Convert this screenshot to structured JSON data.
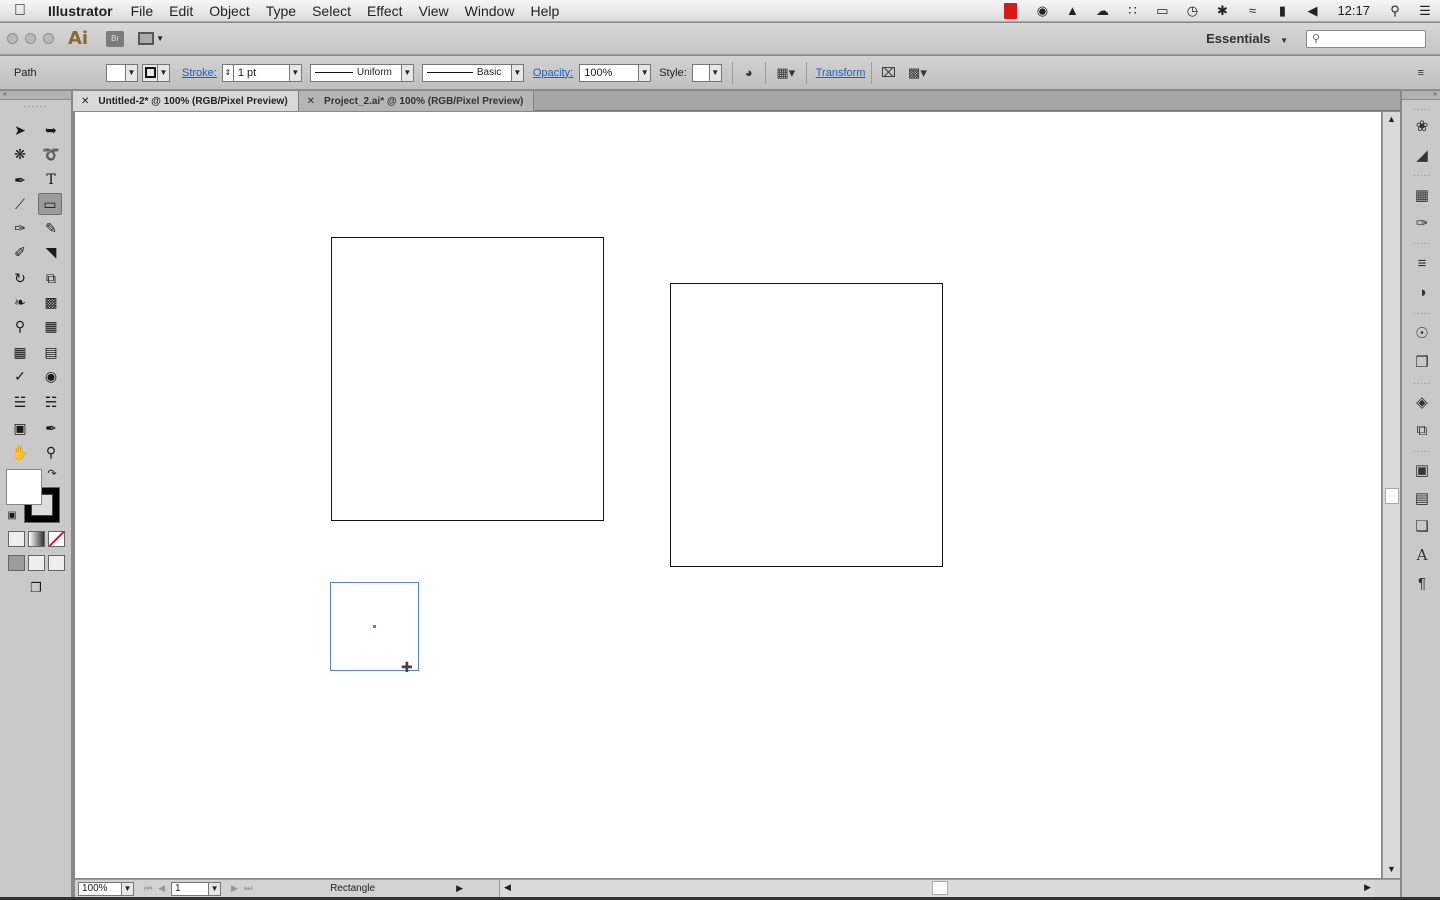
{
  "menubar": {
    "app_name": "Illustrator",
    "items": [
      "File",
      "Edit",
      "Object",
      "Type",
      "Select",
      "Effect",
      "View",
      "Window",
      "Help"
    ],
    "clock": "12:17"
  },
  "appbar": {
    "logo": "Ai",
    "bridge_label": "Br",
    "workspace": "Essentials",
    "search_placeholder": ""
  },
  "control": {
    "selection_type": "Path",
    "stroke_label": "Stroke:",
    "stroke_weight": "1 pt",
    "variable_width": "Uniform",
    "brush": "Basic",
    "opacity_label": "Opacity:",
    "opacity_value": "100%",
    "style_label": "Style:",
    "transform_label": "Transform"
  },
  "tabs": [
    {
      "label": "Untitled-2* @ 100% (RGB/Pixel Preview)",
      "active": true
    },
    {
      "label": "Project_2.ai* @ 100% (RGB/Pixel Preview)",
      "active": false
    }
  ],
  "status": {
    "zoom": "100%",
    "artboard": "1",
    "current_tool": "Rectangle"
  },
  "tools": [
    "selection-tool",
    "direct-selection-tool",
    "magic-wand-tool",
    "lasso-tool",
    "pen-tool",
    "type-tool",
    "line-segment-tool",
    "rectangle-tool",
    "paintbrush-tool",
    "pencil-tool",
    "blob-brush-tool",
    "eraser-tool",
    "rotate-tool",
    "scale-tool",
    "warp-tool",
    "free-transform-tool",
    "shape-builder-tool",
    "perspective-grid-tool",
    "mesh-tool",
    "gradient-tool",
    "eyedropper-tool",
    "blend-tool",
    "symbol-sprayer-tool",
    "column-graph-tool",
    "artboard-tool",
    "slice-tool",
    "hand-tool",
    "zoom-tool"
  ],
  "colors": {
    "accent_link": "#1f5fbf",
    "selection_blue": "#5a7fd6"
  }
}
